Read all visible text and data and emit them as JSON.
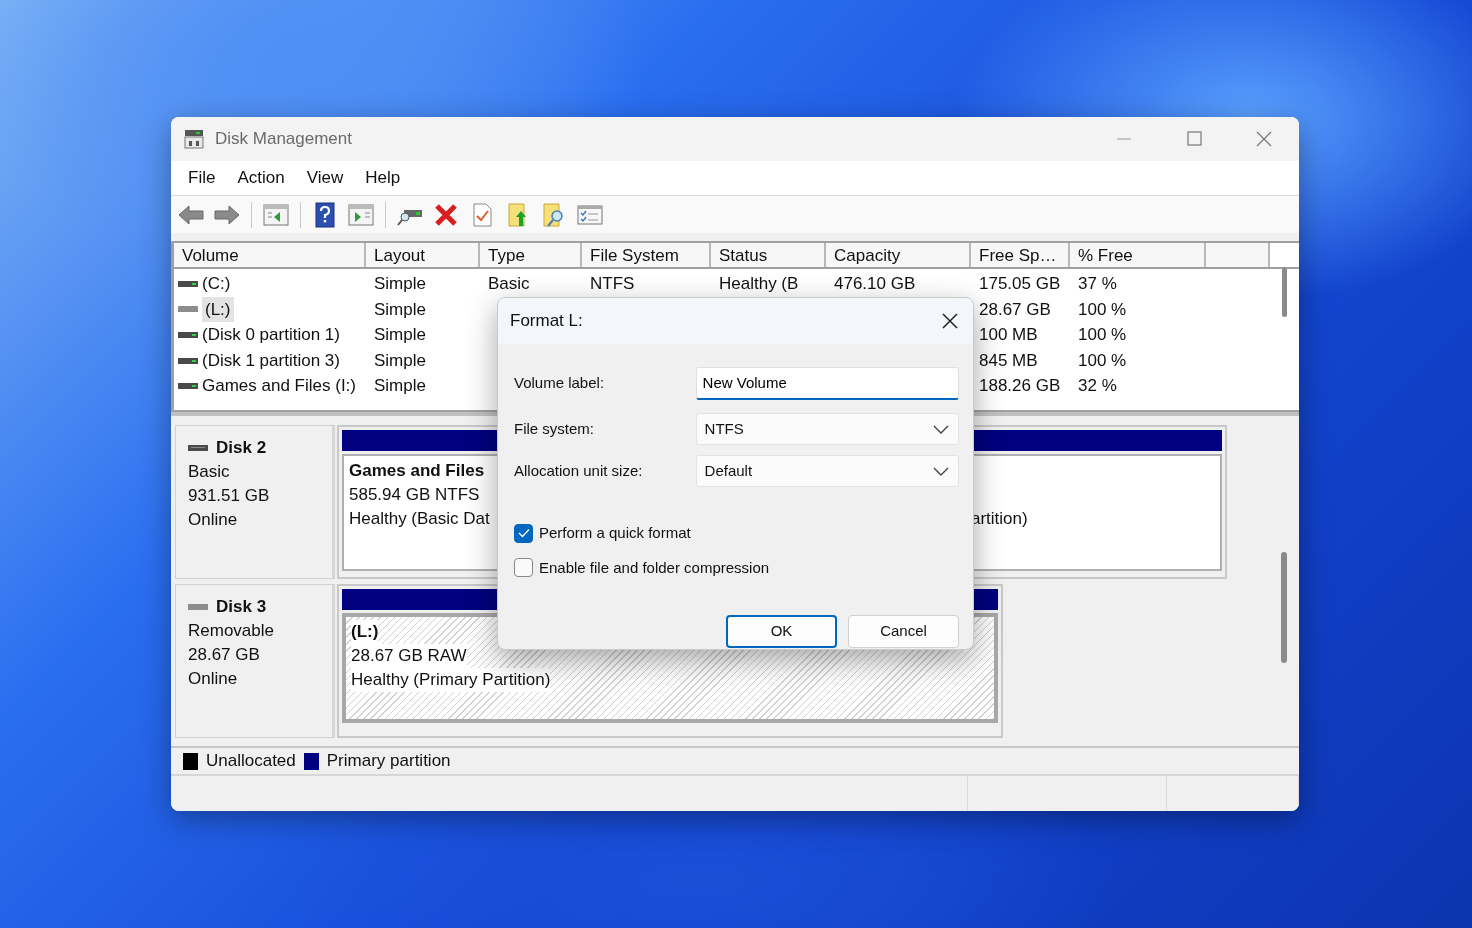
{
  "window": {
    "title": "Disk Management",
    "menu": [
      "File",
      "Action",
      "View",
      "Help"
    ]
  },
  "volume_list": {
    "columns": [
      "Volume",
      "Layout",
      "Type",
      "File System",
      "Status",
      "Capacity",
      "Free Sp…",
      "% Free"
    ],
    "rows": [
      {
        "kind": "fixed",
        "selected": false,
        "volume": "(C:)",
        "layout": "Simple",
        "type": "Basic",
        "file_system": "NTFS",
        "status": "Healthy (B",
        "capacity": "476.10 GB",
        "free_space": "175.05 GB",
        "percent_free": "37 %"
      },
      {
        "kind": "removable",
        "selected": true,
        "volume": "(L:)",
        "layout": "Simple",
        "free_space": "28.67 GB",
        "percent_free": "100 %"
      },
      {
        "kind": "fixed",
        "selected": false,
        "volume": "(Disk 0 partition 1)",
        "layout": "Simple",
        "free_space": "100 MB",
        "percent_free": "100 %"
      },
      {
        "kind": "fixed",
        "selected": false,
        "volume": "(Disk 1 partition 3)",
        "layout": "Simple",
        "free_space": "845 MB",
        "percent_free": "100 %"
      },
      {
        "kind": "fixed",
        "selected": false,
        "volume": "Games and Files (I:)",
        "layout": "Simple",
        "free_space": "188.26 GB",
        "percent_free": "32 %"
      }
    ]
  },
  "disks": [
    {
      "kind": "basic",
      "name": "Disk 2",
      "type": "Basic",
      "size": "931.51 GB",
      "status": "Online",
      "partition": {
        "selected": false,
        "name": "Games and Files",
        "size": "585.94 GB NTFS",
        "health": "Healthy (Basic Dat",
        "health_tail": "artition)"
      }
    },
    {
      "kind": "removable",
      "name": "Disk 3",
      "type": "Removable",
      "size": "28.67 GB",
      "status": "Online",
      "partition": {
        "selected": true,
        "name": "(L:)",
        "size": "28.67 GB RAW",
        "health": "Healthy (Primary Partition)"
      }
    }
  ],
  "legend": [
    {
      "label": "Unallocated",
      "color": "#000000"
    },
    {
      "label": "Primary partition",
      "color": "#000080"
    }
  ],
  "dialog": {
    "title": "Format L:",
    "fields": [
      {
        "kind": "text",
        "label": "Volume label:",
        "value": "New Volume",
        "focused": true
      },
      {
        "kind": "select",
        "label": "File system:",
        "value": "NTFS"
      },
      {
        "kind": "select",
        "label": "Allocation unit size:",
        "value": "Default"
      }
    ],
    "options": [
      {
        "label": "Perform a quick format",
        "checked": true
      },
      {
        "label": "Enable file and folder compression",
        "checked": false
      }
    ],
    "buttons": [
      {
        "label": "OK",
        "default": true
      },
      {
        "label": "Cancel",
        "default": false
      }
    ]
  }
}
